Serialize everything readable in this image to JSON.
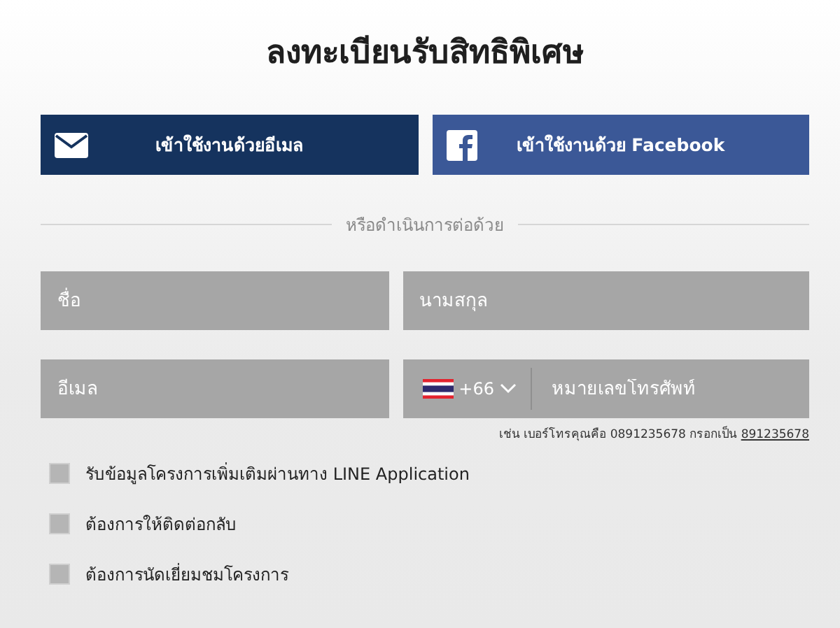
{
  "title": "ลงทะเบียนรับสิทธิพิเศษ",
  "login_buttons": [
    {
      "kind": "email",
      "label": "เข้าใช้งานด้วยอีเมล"
    },
    {
      "kind": "facebook",
      "label": "เข้าใช้งานด้วย Facebook"
    }
  ],
  "divider_text": "หรือดำเนินการต่อด้วย",
  "fields": [
    {
      "kind": "text",
      "placeholder": "ชื่อ"
    },
    {
      "kind": "text",
      "placeholder": "นามสกุล"
    },
    {
      "kind": "text",
      "placeholder": "อีเมล"
    },
    {
      "kind": "phone",
      "country_code": "+66",
      "placeholder": "หมายเลขโทรศัพท์"
    }
  ],
  "phone_hint": {
    "text": "เช่น เบอร์โทรคุณคือ 0891235678 กรอกเป็น",
    "link": "891235678"
  },
  "options": [
    {
      "label": "รับข้อมูลโครงการเพิ่มเติมผ่านทาง LINE Application",
      "checked": false
    },
    {
      "label": "ต้องการให้ติดต่อกลับ",
      "checked": false
    },
    {
      "label": "ต้องการนัดเยี่ยมชมโครงการ",
      "checked": false
    }
  ]
}
